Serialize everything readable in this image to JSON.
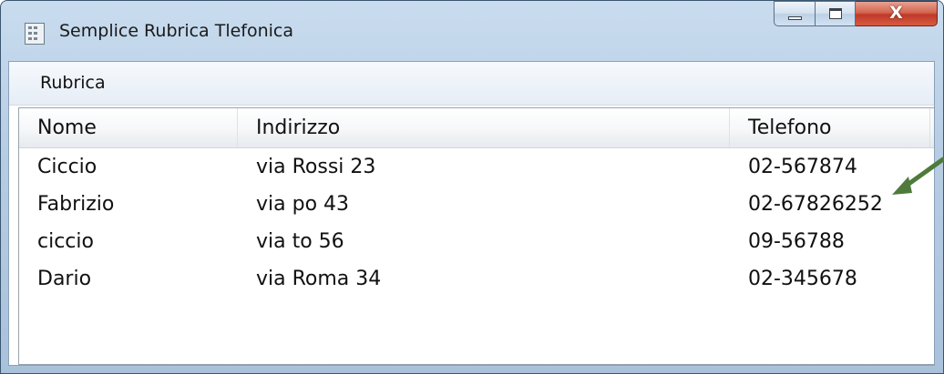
{
  "window": {
    "title": "Semplice Rubrica Tlefonica",
    "close_glyph": "X",
    "icons": [
      "app-icon",
      "minimize-icon",
      "maximize-icon",
      "close-icon"
    ]
  },
  "menubar": {
    "items": [
      {
        "label": "Rubrica"
      }
    ]
  },
  "table": {
    "columns": [
      "Nome",
      "Indirizzo",
      "Telefono"
    ],
    "rows": [
      {
        "nome": "Ciccio",
        "indirizzo": "via Rossi 23",
        "telefono": "02-567874"
      },
      {
        "nome": "Fabrizio",
        "indirizzo": "via po 43",
        "telefono": "02-67826252"
      },
      {
        "nome": "ciccio",
        "indirizzo": "via to 56",
        "telefono": "09-56788"
      },
      {
        "nome": "Dario",
        "indirizzo": "via Roma 34",
        "telefono": "02-345678"
      }
    ]
  },
  "colors": {
    "annotation_arrow": "#4e7a3c",
    "close_button": "#c0392b",
    "titlebar": "#b7cde4"
  }
}
